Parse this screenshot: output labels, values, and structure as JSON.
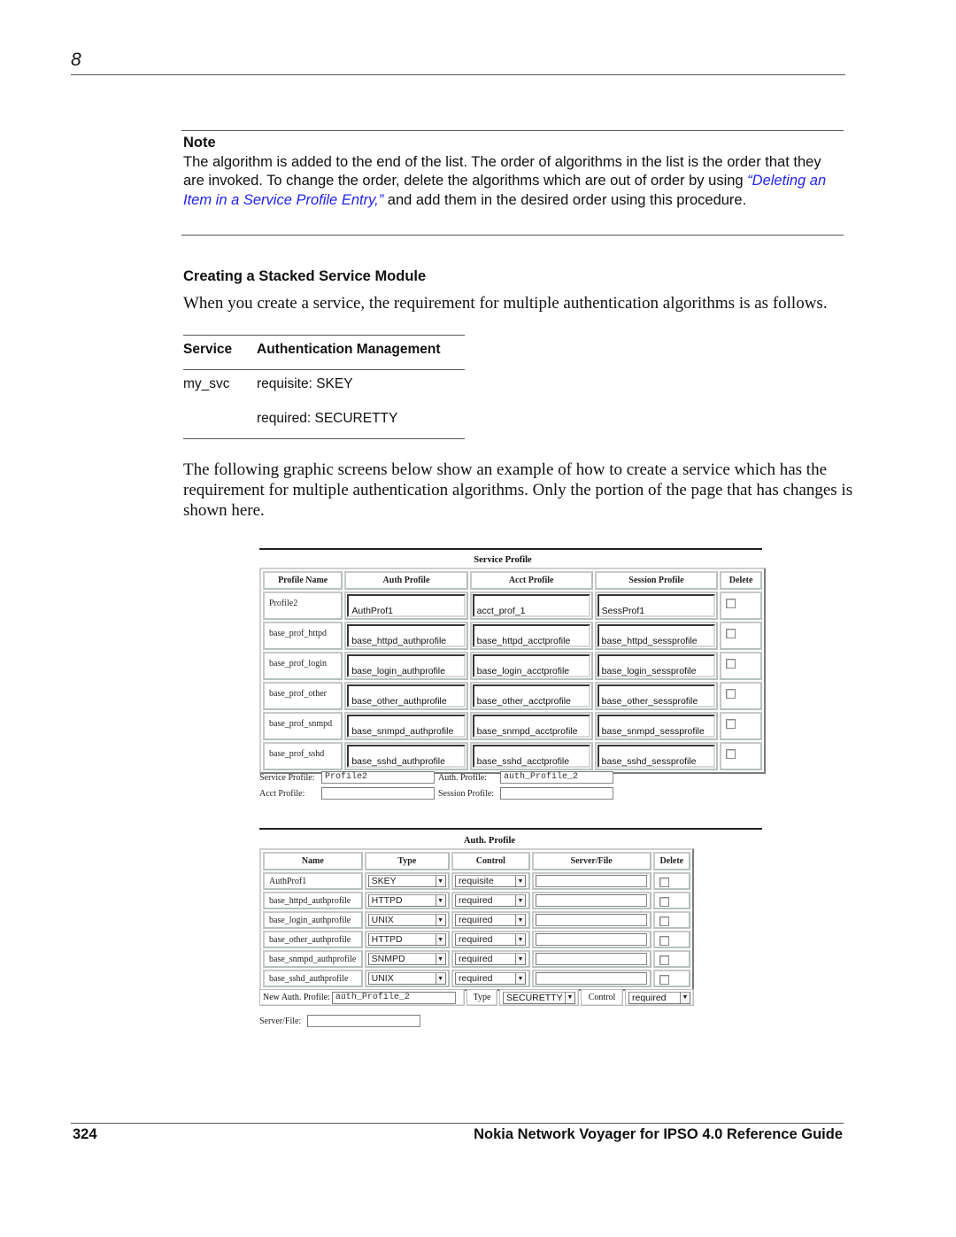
{
  "header": {
    "chapter_number": "8"
  },
  "note": {
    "title": "Note",
    "text_before_link": "The algorithm is added to the end of the list. The order of algorithms in the list is the order that they are invoked. To change the order, delete the algorithms which are out of order by using ",
    "link_text": "“Deleting an Item in a Service Profile Entry,”",
    "text_after_link": " and add them in the desired order using this procedure."
  },
  "section": {
    "heading": "Creating a Stacked Service Module",
    "intro": "When you create a service, the requirement for multiple authentication algorithms is as follows.",
    "service_table": {
      "headers": [
        "Service",
        "Authentication Management"
      ],
      "rows": [
        {
          "service": "my_svc",
          "auth": "requisite: SKEY"
        },
        {
          "service": "",
          "auth": "required: SECURETTY"
        }
      ]
    },
    "para2": "The following graphic screens below show an example of how to create a service which has the requirement for multiple authentication algorithms. Only the portion of the page that has changes is shown here."
  },
  "service_profile_form": {
    "title": "Service Profile",
    "columns": [
      "Profile Name",
      "Auth Profile",
      "Acct Profile",
      "Session Profile",
      "Delete"
    ],
    "rows": [
      {
        "name": "Profile2",
        "auth": "AuthProf1",
        "acct": "acct_prof_1",
        "sess": "SessProf1",
        "delete": false
      },
      {
        "name": "base_prof_httpd",
        "auth": "base_httpd_authprofile",
        "acct": "base_httpd_acctprofile",
        "sess": "base_httpd_sessprofile",
        "delete": false
      },
      {
        "name": "base_prof_login",
        "auth": "base_login_authprofile",
        "acct": "base_login_acctprofile",
        "sess": "base_login_sessprofile",
        "delete": false
      },
      {
        "name": "base_prof_other",
        "auth": "base_other_authprofile",
        "acct": "base_other_acctprofile",
        "sess": "base_other_sessprofile",
        "delete": false
      },
      {
        "name": "base_prof_snmpd",
        "auth": "base_snmpd_authprofile",
        "acct": "base_snmpd_acctprofile",
        "sess": "base_snmpd_sessprofile",
        "delete": false
      },
      {
        "name": "base_prof_sshd",
        "auth": "base_sshd_authprofile",
        "acct": "base_sshd_acctprofile",
        "sess": "base_sshd_sessprofile",
        "delete": false
      }
    ],
    "new_entry": {
      "service_profile_label": "Service Profile:",
      "service_profile_value": "Profile2",
      "auth_profile_label": "Auth. Profile:",
      "auth_profile_value": "auth_Profile_2",
      "acct_profile_label": "Acct Profile:",
      "acct_profile_value": "",
      "session_profile_label": "Session Profile:",
      "session_profile_value": ""
    }
  },
  "auth_profile_form": {
    "title": "Auth. Profile",
    "columns": [
      "Name",
      "Type",
      "Control",
      "Server/File",
      "Delete"
    ],
    "rows": [
      {
        "name": "AuthProf1",
        "type": "SKEY",
        "control": "requisite",
        "server": "",
        "delete": false
      },
      {
        "name": "base_httpd_authprofile",
        "type": "HTTPD",
        "control": "required",
        "server": "",
        "delete": false
      },
      {
        "name": "base_login_authprofile",
        "type": "UNIX",
        "control": "required",
        "server": "",
        "delete": false
      },
      {
        "name": "base_other_authprofile",
        "type": "HTTPD",
        "control": "required",
        "server": "",
        "delete": false
      },
      {
        "name": "base_snmpd_authprofile",
        "type": "SNMPD",
        "control": "required",
        "server": "",
        "delete": false
      },
      {
        "name": "base_sshd_authprofile",
        "type": "UNIX",
        "control": "required",
        "server": "",
        "delete": false
      }
    ],
    "new_entry": {
      "new_auth_label": "New Auth. Profile:",
      "new_auth_value": "auth_Profile_2",
      "type_label": "Type",
      "type_value": "SECURETTY",
      "control_label": "Control",
      "control_value": "required",
      "server_label": "Server/File:",
      "server_value": ""
    }
  },
  "footer": {
    "page_number": "324",
    "guide_title": "Nokia Network Voyager for IPSO 4.0 Reference Guide"
  },
  "colors": {
    "link": "#2222ee",
    "rule": "#555555"
  }
}
